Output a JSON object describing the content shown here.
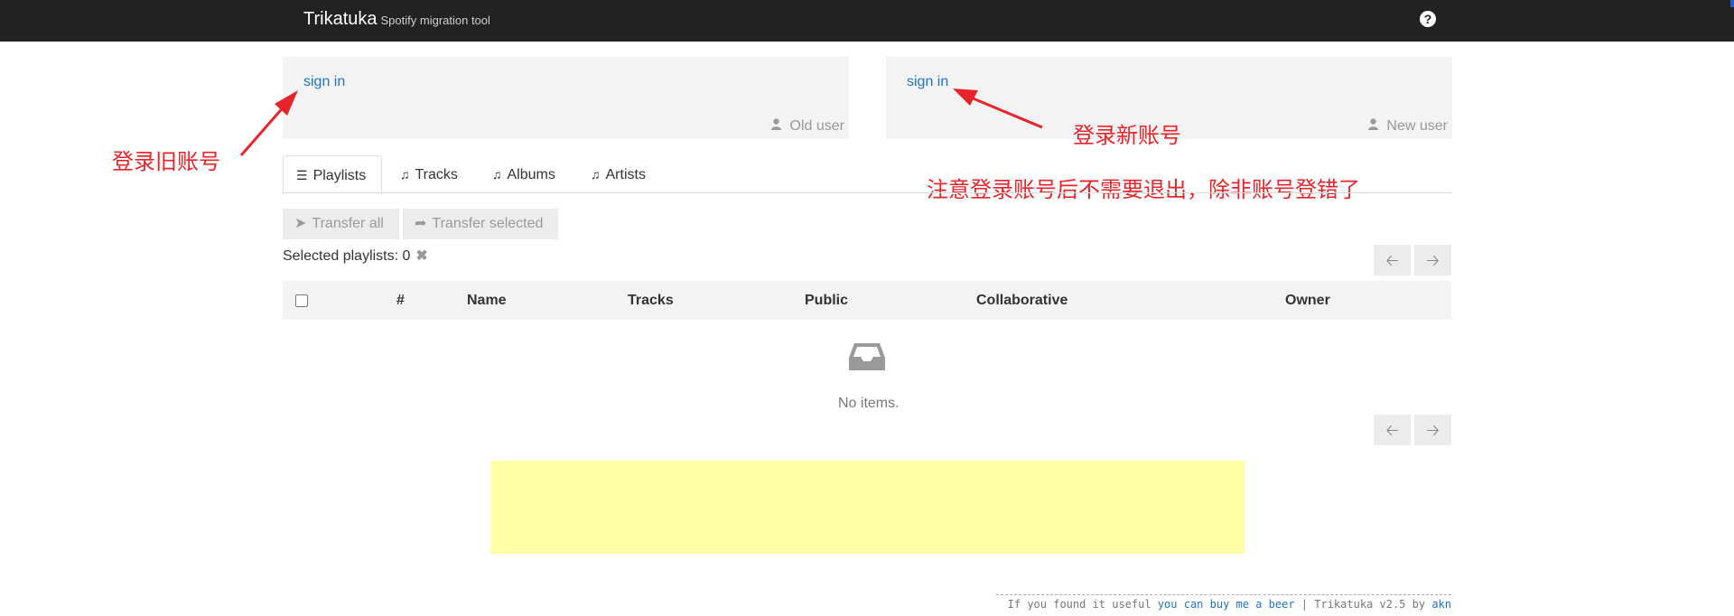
{
  "app": {
    "title": "Trikatuka",
    "subtitle": "Spotify migration tool",
    "help_glyph": "?"
  },
  "old_user": {
    "signin_label": "sign in",
    "label": "Old user"
  },
  "new_user": {
    "signin_label": "sign in",
    "label": "New user"
  },
  "annotations": {
    "login_old": "登录旧账号",
    "login_new": "登录新账号",
    "note": "注意登录账号后不需要退出，除非账号登错了"
  },
  "tabs": [
    {
      "label": "Playlists",
      "icon": "list-icon"
    },
    {
      "label": "Tracks",
      "icon": "music-icon"
    },
    {
      "label": "Albums",
      "icon": "music-icon"
    },
    {
      "label": "Artists",
      "icon": "music-icon"
    }
  ],
  "actions": {
    "transfer_all": "Transfer all",
    "transfer_selected": "Transfer selected"
  },
  "selection": {
    "label": "Selected playlists:",
    "count": "0",
    "clear_glyph": "✖"
  },
  "table": {
    "columns": [
      "#",
      "Name",
      "Tracks",
      "Public",
      "Collaborative",
      "Owner"
    ],
    "empty_text": "No items."
  },
  "footer": {
    "prefix": "If you found it useful",
    "link": "you can buy me a beer",
    "separator": "|",
    "version_text": "Trikatuka v2.5 by",
    "author": "akn"
  },
  "colors": {
    "navbar": "#222222",
    "link": "#1f73c4",
    "panel": "#f3f3f3",
    "annotation": "#e8242b",
    "ad_box": "#ffffa5"
  }
}
